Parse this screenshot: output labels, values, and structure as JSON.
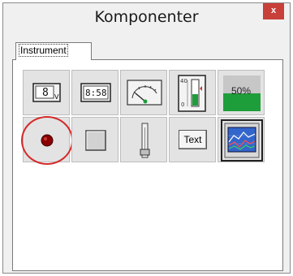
{
  "window": {
    "title": "Komponenter",
    "close_label": "x"
  },
  "tabs": [
    {
      "label": "Instrument",
      "active": true
    }
  ],
  "tools": [
    {
      "name": "digital-numeric-display",
      "icon": "digit-display-icon",
      "display_text": "8",
      "unit": "V"
    },
    {
      "name": "digital-clock-display",
      "icon": "clock-display-icon",
      "display_text": "8:58"
    },
    {
      "name": "analog-gauge",
      "icon": "gauge-icon"
    },
    {
      "name": "bar-meter",
      "icon": "bar-meter-icon",
      "scale_max": "40",
      "scale_min": "0",
      "level_fraction": 0.45
    },
    {
      "name": "percent-indicator",
      "icon": "percent-fill-icon",
      "label": "50%",
      "level_fraction": 0.5
    },
    {
      "name": "led-indicator",
      "icon": "led-icon",
      "highlighted": true
    },
    {
      "name": "push-button",
      "icon": "button-icon"
    },
    {
      "name": "slider",
      "icon": "slider-icon"
    },
    {
      "name": "text-label",
      "icon": "text-icon",
      "label": "Text"
    },
    {
      "name": "chart-graph",
      "icon": "graph-icon"
    }
  ],
  "colors": {
    "close_button": "#c7403a",
    "led": "#8b0000",
    "meter_fill": "#1e9e3a",
    "highlight_ring": "#d42a2a"
  }
}
